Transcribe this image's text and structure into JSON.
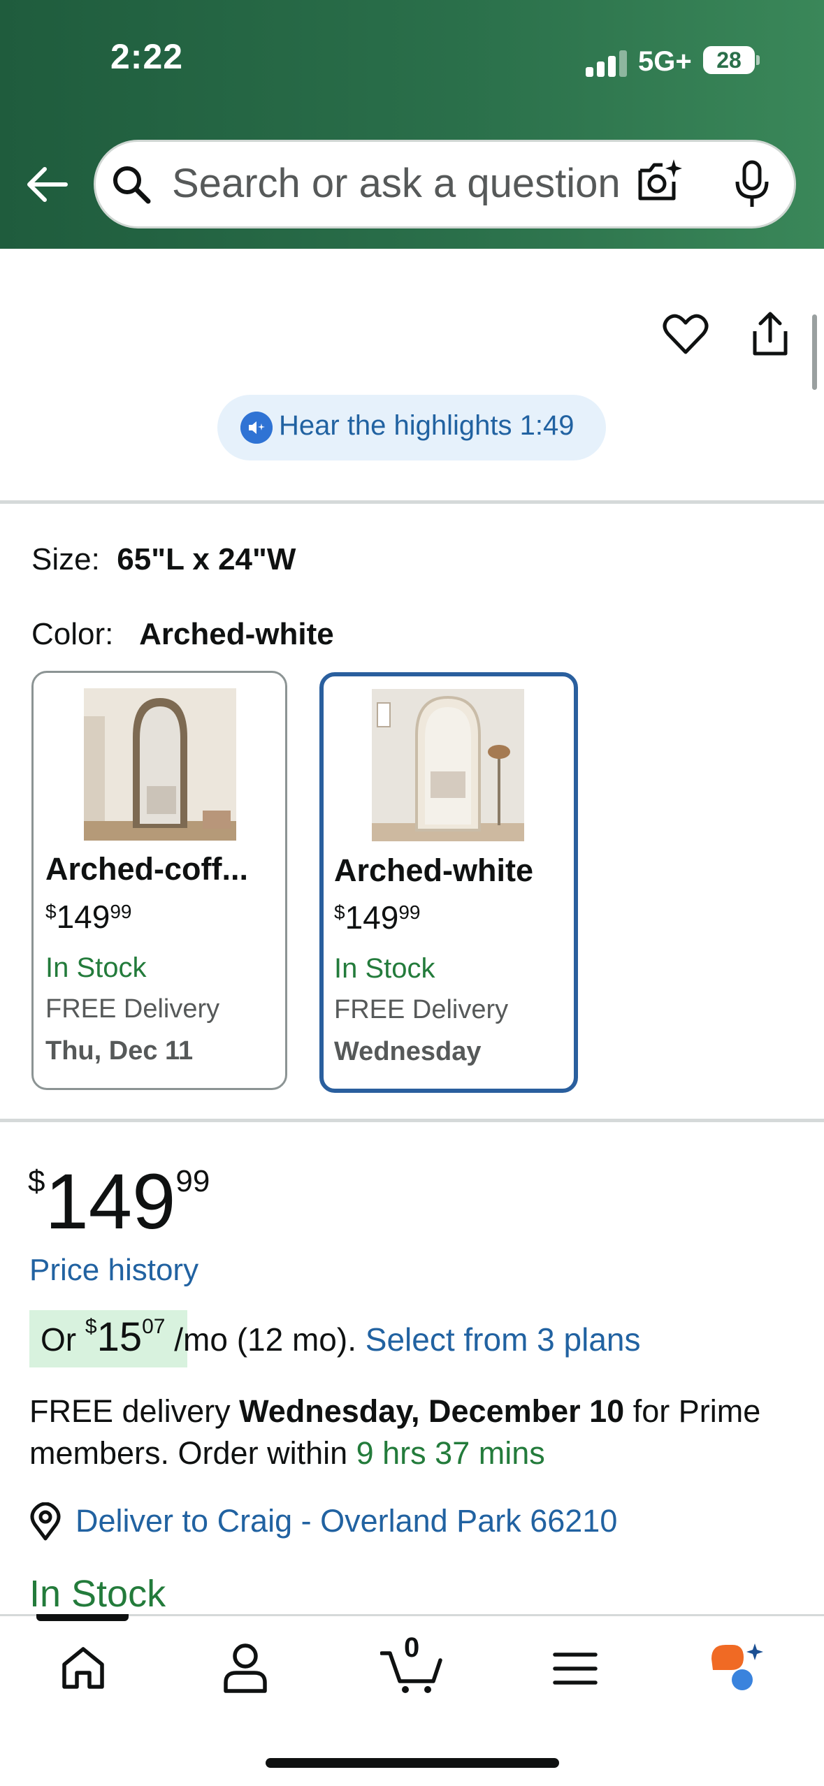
{
  "status_bar": {
    "time": "2:22",
    "network": "5G+",
    "battery": "28"
  },
  "search": {
    "placeholder": "Search or ask a question"
  },
  "highlights": {
    "label": "Hear the highlights 1:49"
  },
  "size": {
    "label": "Size:",
    "value": "65\"L x 24\"W"
  },
  "color": {
    "label": "Color:",
    "value": "Arched-white"
  },
  "variations": [
    {
      "name": "Arched-coff...",
      "price_symbol": "$",
      "price_whole": "149",
      "price_fraction": "99",
      "stock": "In Stock",
      "delivery": "FREE Delivery",
      "delivery_date": "Thu, Dec 11",
      "selected": false
    },
    {
      "name": "Arched-white",
      "price_symbol": "$",
      "price_whole": "149",
      "price_fraction": "99",
      "stock": "In Stock",
      "delivery": "FREE Delivery",
      "delivery_date": "Wednesday",
      "selected": true
    }
  ],
  "price": {
    "symbol": "$",
    "whole": "149",
    "fraction": "99"
  },
  "price_history_link": "Price history",
  "installment": {
    "prefix": "Or ",
    "symbol": "$",
    "whole": "15",
    "fraction": "07",
    "suffix": "/mo (12 mo). ",
    "link": "Select from 3 plans"
  },
  "delivery": {
    "prefix": "FREE delivery ",
    "date": "Wednesday, December 10",
    "middle": " for Prime members. Order within ",
    "countdown": "9 hrs 37 mins"
  },
  "deliver_to": "Deliver to Craig - Overland Park 66210",
  "stock_status": "In Stock",
  "tabbar": {
    "cart_count": "0"
  },
  "colors": {
    "header_green": "#2a6f4a",
    "link_blue": "#2162a1",
    "stock_green": "#237b3b",
    "selected_border": "#2a5f9e",
    "badge_green": "#d8f2de"
  },
  "icons": [
    "back-arrow-icon",
    "search-icon",
    "camera-lens-icon",
    "microphone-icon",
    "heart-icon",
    "share-icon",
    "speaker-icon",
    "location-pin-icon",
    "home-icon",
    "profile-icon",
    "cart-icon",
    "menu-icon",
    "rufus-assistant-icon"
  ]
}
